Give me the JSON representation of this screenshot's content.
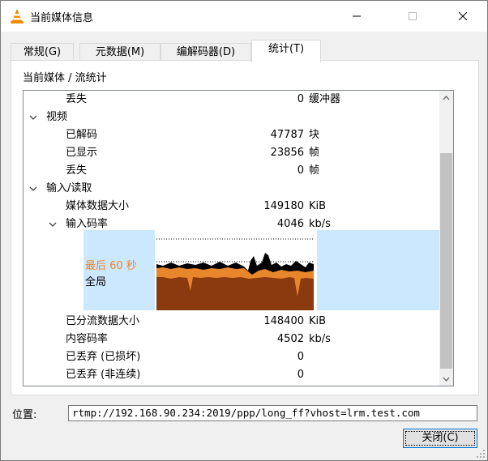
{
  "window": {
    "title": "当前媒体信息"
  },
  "tabs": [
    {
      "label": "常规(G)"
    },
    {
      "label": "元数据(M)"
    },
    {
      "label": "编解码器(D)"
    },
    {
      "label": "统计(T)"
    }
  ],
  "breadcrumb": "当前媒体 / 流统计",
  "tree": {
    "rows": [
      {
        "label": "丢失",
        "value": "0",
        "unit": "缓冲器"
      },
      {
        "label": "视频"
      },
      {
        "label": "已解码",
        "value": "47787",
        "unit": "块"
      },
      {
        "label": "已显示",
        "value": "23856",
        "unit": "帧"
      },
      {
        "label": "丢失",
        "value": "0",
        "unit": "帧"
      },
      {
        "label": "输入/读取"
      },
      {
        "label": "媒体数据大小",
        "value": "149180",
        "unit": "KiB"
      },
      {
        "label": "输入码率",
        "value": "4046",
        "unit": "kb/s"
      },
      {
        "label": "已分流数据大小",
        "value": "148400",
        "unit": "KiB"
      },
      {
        "label": "内容码率",
        "value": "4502",
        "unit": "kb/s"
      },
      {
        "label": "已丢弃 (已损坏)",
        "value": "0"
      },
      {
        "label": "已丢弃 (非连续)",
        "value": "0"
      }
    ],
    "graph_legend": {
      "recent": "最后 60 秒",
      "global": "全局"
    }
  },
  "location": {
    "label": "位置:",
    "value": "rtmp://192.168.90.234:2019/ppp/long_ff?vhost=lrm.test.com"
  },
  "close_button": "关闭(C)",
  "colors": {
    "accent": "#0078d7",
    "graph_brown": "#8b3a0f",
    "graph_orange": "#e8862c",
    "graph_bg": "#cce8ff"
  }
}
